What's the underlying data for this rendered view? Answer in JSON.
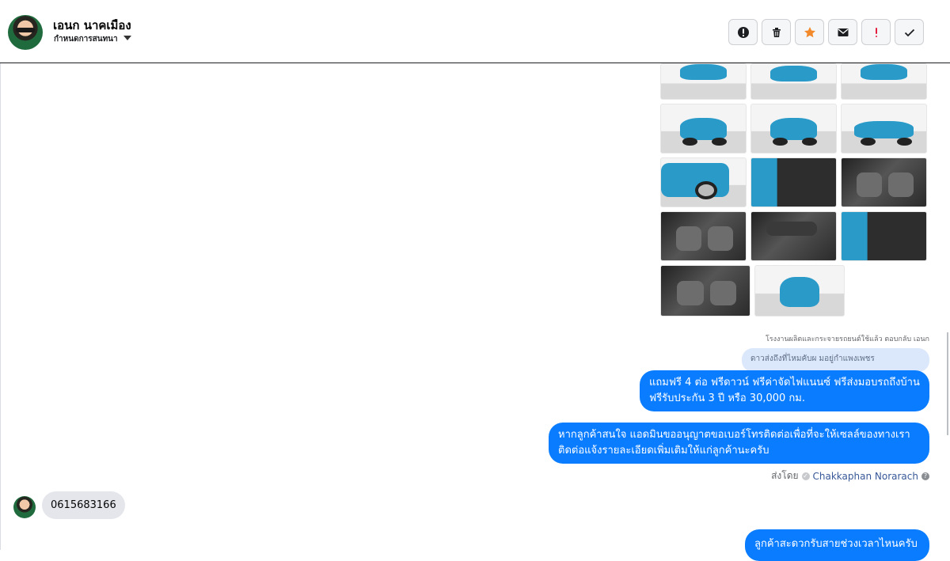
{
  "header": {
    "contact_name": "เอนก นาคเมือง",
    "subtitle": "กำหนดการสนทนา",
    "actions": [
      {
        "name": "block-icon",
        "color": "#1c1e21"
      },
      {
        "name": "trash-icon",
        "color": "#1c1e21"
      },
      {
        "name": "star-icon",
        "color": "#f28a2b"
      },
      {
        "name": "mail-icon",
        "color": "#1c1e21"
      },
      {
        "name": "exclamation-icon",
        "color": "#e41e3f"
      },
      {
        "name": "check-icon",
        "color": "#1c1e21"
      }
    ]
  },
  "messages": {
    "reply_note": "โรงงานผลิตและกระจายรถยนต์ใช้แล้ว ตอบกลับ เอนก",
    "quoted_text": "ดาวส่งถึงที่ไหมคับผ มอยู่กำแพงเพชร",
    "outgoing": [
      "แถมฟรี 4 ต่อ ฟรีดาวน์ ฟรีค่าจัดไฟแนนซ์ ฟรีส่งมอบรถถึงบ้าน",
      "ฟรีรับประกัน 3 ปี หรือ 30,000 กม.",
      "หากลูกค้าสนใจ แอดมินขออนุญาตขอเบอร์โทรติดต่อเพื่อที่จะให้เซลล์ของทางเรา",
      "ติดต่อแจ้งรายละเอียดเพิ่มเติมให้แก่ลูกค้านะครับ"
    ],
    "sent_by_label": "ส่งโดย",
    "sent_by_name": "Chakkaphan Norarach",
    "incoming_phone": "0615683166",
    "partial_outgoing": "ลูกค้าสะดวกรับสายช่วงเวลาไหนครับ"
  },
  "colors": {
    "outgoing_bubble": "#0a7cff",
    "incoming_bubble": "#e4e6eb",
    "quoted_bubble": "#dbe7fb"
  }
}
